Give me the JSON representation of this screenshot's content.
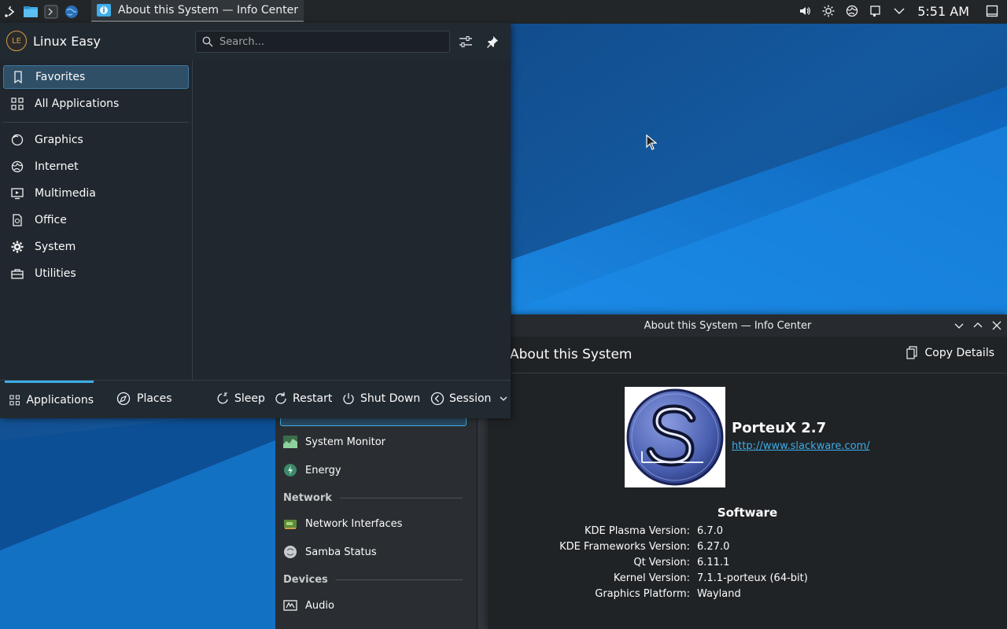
{
  "panel": {
    "task_title": "About this System — Info Center",
    "clock": "5:51 AM",
    "tray_icons": [
      "volume-icon",
      "brightness-icon",
      "network-icon",
      "clipboard-icon",
      "chevron-down-icon"
    ]
  },
  "launcher": {
    "user_initials": "LE",
    "user_name": "Linux Easy",
    "search_placeholder": "Search...",
    "categories": [
      {
        "label": "Favorites",
        "icon": "bookmark-icon"
      },
      {
        "label": "All Applications",
        "icon": "grid-icon"
      },
      {
        "label": "Graphics",
        "icon": "palette-icon"
      },
      {
        "label": "Internet",
        "icon": "globe-icon"
      },
      {
        "label": "Multimedia",
        "icon": "monitor-play-icon"
      },
      {
        "label": "Office",
        "icon": "document-icon"
      },
      {
        "label": "System",
        "icon": "gear-icon"
      },
      {
        "label": "Utilities",
        "icon": "toolbox-icon"
      }
    ],
    "footer": {
      "applications": "Applications",
      "places": "Places",
      "sleep": "Sleep",
      "restart": "Restart",
      "shutdown": "Shut Down",
      "session": "Session"
    }
  },
  "infocenter": {
    "window_title": "About this System — Info Center",
    "page_title": "About this System",
    "copy_details": "Copy Details",
    "distro_name": "PorteuX 2.7",
    "distro_url": "http://www.slackware.com/",
    "software_heading": "Software",
    "software": [
      {
        "key": "KDE Plasma Version:",
        "value": "6.7.0"
      },
      {
        "key": "KDE Frameworks Version:",
        "value": "6.27.0"
      },
      {
        "key": "Qt Version:",
        "value": "6.11.1"
      },
      {
        "key": "Kernel Version:",
        "value": "7.1.1-porteux (64-bit)"
      },
      {
        "key": "Graphics Platform:",
        "value": "Wayland"
      }
    ],
    "sidebar": {
      "items": [
        {
          "label": "System Monitor"
        },
        {
          "label": "Energy"
        },
        {
          "label": "Network Interfaces"
        },
        {
          "label": "Samba Status"
        },
        {
          "label": "Audio"
        }
      ],
      "categories": [
        "Network",
        "Devices"
      ]
    }
  }
}
